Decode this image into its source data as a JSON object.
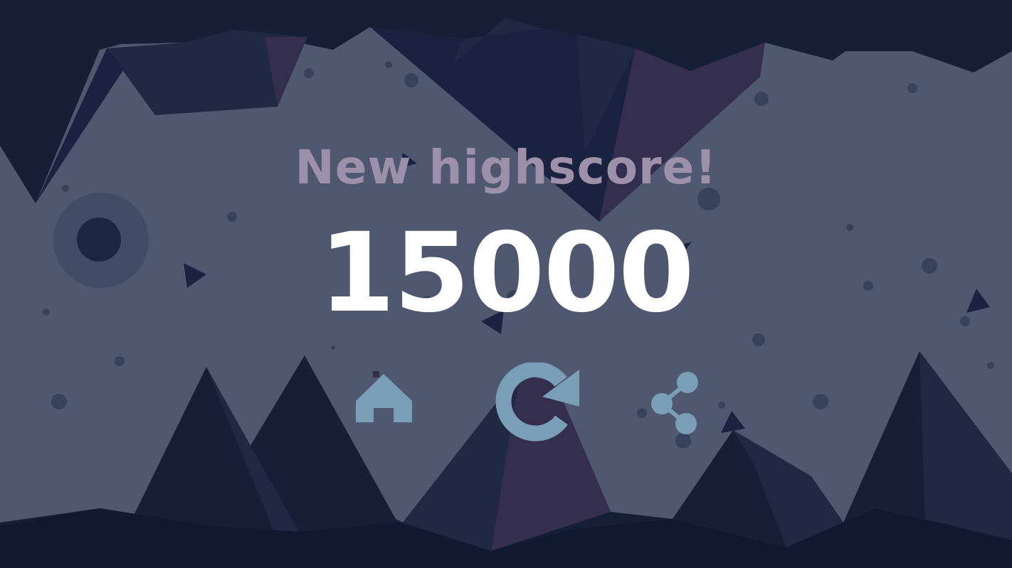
{
  "game_over": {
    "headline": "New highscore!",
    "score": "15000"
  },
  "actions": {
    "home": {
      "icon": "home-icon"
    },
    "replay": {
      "icon": "replay-icon"
    },
    "share": {
      "icon": "share-icon"
    }
  },
  "colors": {
    "sky": "#505871",
    "rock_dark": "#161e38",
    "rock_mid": "#212843",
    "rock_purple": "#352f4f",
    "headline": "#9d90aa",
    "score": "#ffffff",
    "button": "#7a9eb6",
    "particle": "#38425c"
  }
}
